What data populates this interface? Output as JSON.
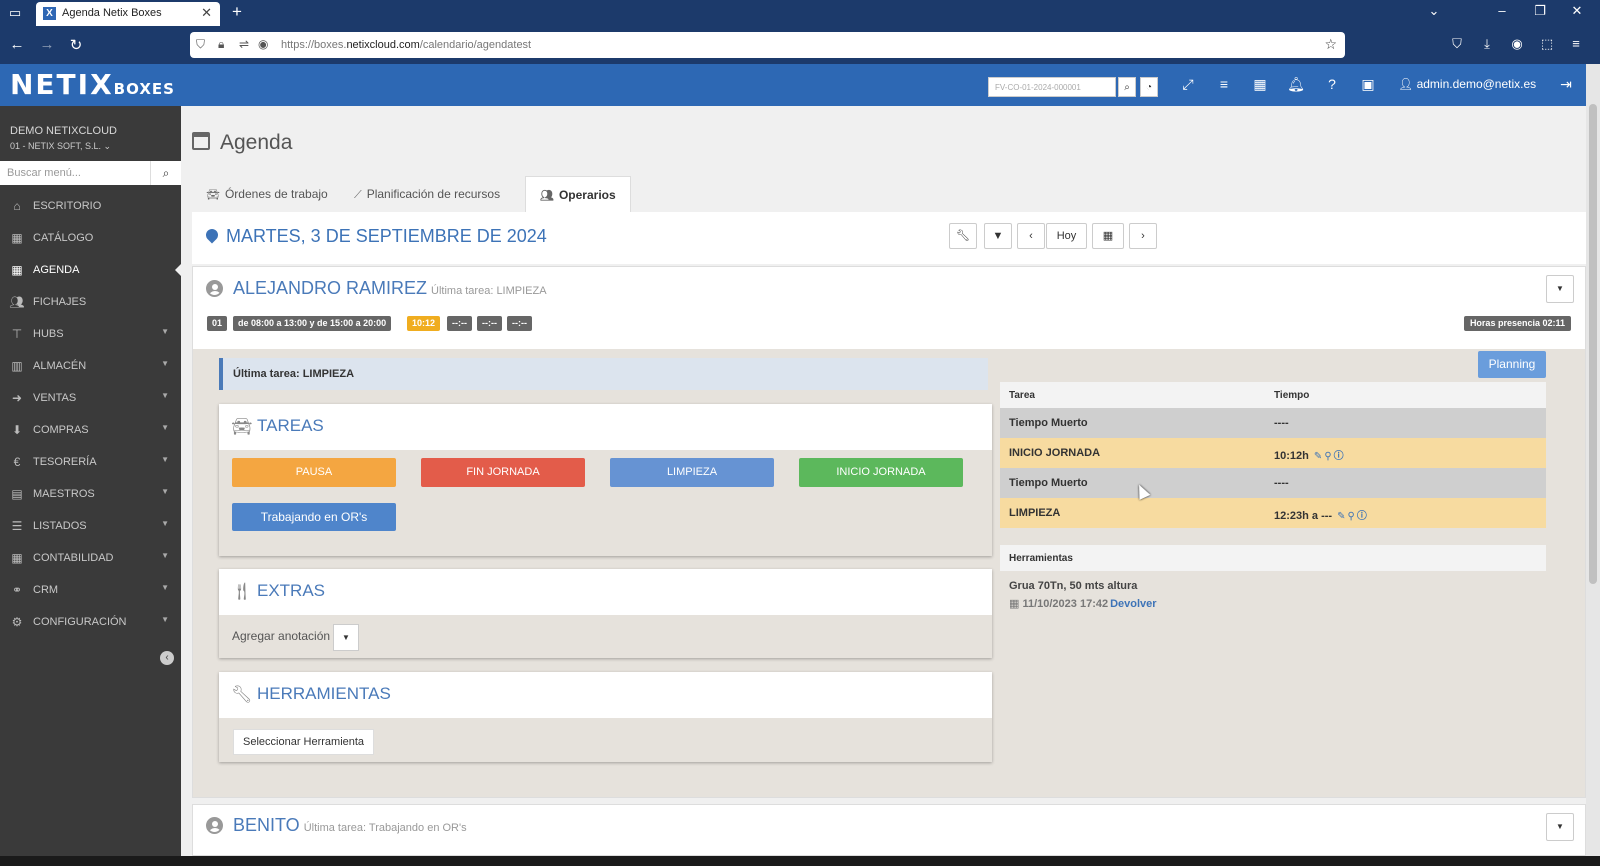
{
  "browser": {
    "tab_title": "Agenda Netix Boxes",
    "url_prefix": "https://boxes.",
    "url_domain": "netixcloud.com",
    "url_path": "/calendario/agendatest"
  },
  "header": {
    "logo_main": "NETIX",
    "logo_sub": "BOXES",
    "search_placeholder": "FV-CO-01-2024-000001",
    "user_email": "admin.demo@netix.es"
  },
  "sidebar": {
    "company_name": "DEMO NETIXCLOUD",
    "company_sub": "01 - NETIX SOFT, S.L. ⌄",
    "search_placeholder": "Buscar menú...",
    "items": [
      {
        "label": "ESCRITORIO",
        "icon": "home-icon"
      },
      {
        "label": "CATÁLOGO",
        "icon": "grid-icon"
      },
      {
        "label": "AGENDA",
        "icon": "calendar-icon"
      },
      {
        "label": "FICHAJES",
        "icon": "users-icon"
      },
      {
        "label": "HUBS",
        "icon": "hub-icon"
      },
      {
        "label": "ALMACÉN",
        "icon": "barcode-icon"
      },
      {
        "label": "VENTAS",
        "icon": "sales-icon"
      },
      {
        "label": "COMPRAS",
        "icon": "purchases-icon"
      },
      {
        "label": "TESORERÍA",
        "icon": "euro-icon"
      },
      {
        "label": "MAESTROS",
        "icon": "book-icon"
      },
      {
        "label": "LISTADOS",
        "icon": "list-icon"
      },
      {
        "label": "CONTABILIDAD",
        "icon": "table-icon"
      },
      {
        "label": "CRM",
        "icon": "handshake-icon"
      },
      {
        "label": "CONFIGURACIÓN",
        "icon": "gear-icon"
      }
    ]
  },
  "page": {
    "title": "Agenda",
    "tabs": [
      {
        "label": "Órdenes de trabajo"
      },
      {
        "label": "Planificación de recursos"
      },
      {
        "label": "Operarios"
      }
    ],
    "date": "MARTES, 3 DE SEPTIEMBRE DE 2024",
    "buttons": {
      "today": "Hoy",
      "prev": "‹",
      "next": "›"
    }
  },
  "operator": {
    "name": "ALEJANDRO RAMIREZ",
    "last_task_sub": "Última tarea: LIMPIEZA",
    "badges": [
      "01",
      "de 08:00 a 13:00 y de 15:00 a 20:00",
      "10:12",
      "--:--",
      "--:--",
      "--:--"
    ],
    "presence": "Horas presencia 02:11",
    "last_task_box": "Última tarea: LIMPIEZA",
    "tasks_title": "TAREAS",
    "task_buttons": [
      "PAUSA",
      "FIN JORNADA",
      "LIMPIEZA",
      "INICIO JORNADA"
    ],
    "working_button": "Trabajando en OR's",
    "extras_title": "EXTRAS",
    "add_annotation": "Agregar anotación",
    "tools_title": "HERRAMIENTAS",
    "select_tool": "Seleccionar Herramienta",
    "planning": "Planning",
    "table": {
      "headers": [
        "Tarea",
        "Tiempo"
      ],
      "rows": [
        {
          "task": "Tiempo Muerto",
          "time": "----"
        },
        {
          "task": "INICIO JORNADA",
          "time": "10:12h"
        },
        {
          "task": "Tiempo Muerto",
          "time": "----"
        },
        {
          "task": "LIMPIEZA",
          "time": "12:23h a ---"
        }
      ]
    },
    "tools_header": "Herramientas",
    "tool_name": "Grua 70Tn, 50 mts altura",
    "tool_date": "11/10/2023 17:42",
    "tool_return": "Devolver"
  },
  "operator2": {
    "name": "BENITO",
    "last_task_sub": "Última tarea: Trabajando en OR's"
  }
}
